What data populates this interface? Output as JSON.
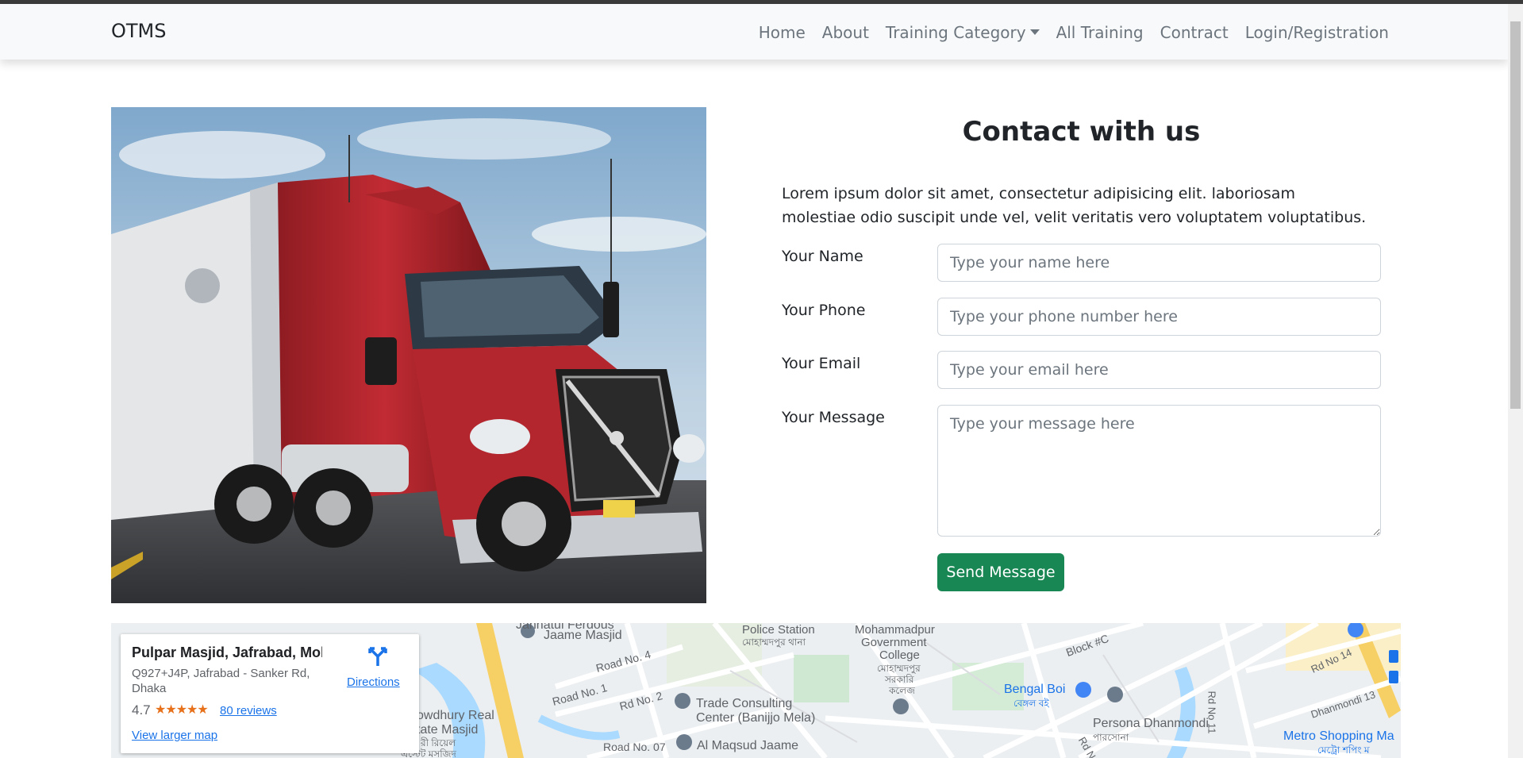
{
  "navbar": {
    "brand": "OTMS",
    "items": [
      {
        "label": "Home"
      },
      {
        "label": "About"
      },
      {
        "label": "Training Category",
        "has_dropdown": true
      },
      {
        "label": "All Training"
      },
      {
        "label": "Contract"
      },
      {
        "label": "Login/Registration"
      }
    ]
  },
  "hero_image": {
    "alt": "Red semi truck",
    "icon": "truck-photo"
  },
  "contact": {
    "title": "Contact with us",
    "intro": "Lorem ipsum dolor sit amet, consectetur adipisicing elit. laboriosam molestiae odio suscipit unde vel, velit veritatis vero voluptatem voluptatibus.",
    "fields": {
      "name": {
        "label": "Your Name",
        "placeholder": "Type your name here",
        "value": ""
      },
      "phone": {
        "label": "Your Phone",
        "placeholder": "Type your phone number here",
        "value": ""
      },
      "email": {
        "label": "Your Email",
        "placeholder": "Type your email here",
        "value": ""
      },
      "message": {
        "label": "Your Message",
        "placeholder": "Type your message here",
        "value": ""
      }
    },
    "submit_label": "Send Message",
    "submit_color": "#198754"
  },
  "map": {
    "card": {
      "place_name": "Pulpar Masjid, Jafrabad, Moh...",
      "address": "Q927+J4P, Jafrabad - Sanker Rd, Dhaka",
      "rating": "4.7",
      "stars": "★★★★★",
      "reviews": "80 reviews",
      "larger_map": "View larger map",
      "directions": "Directions"
    },
    "labels": {
      "jannatul": "Jannatul Ferdous",
      "jaame": "Jaame Masjid",
      "police1": "Police Station",
      "police2": "মোহাম্মদপুর থানা",
      "gov1": "Mohammadpur",
      "gov2": "Government",
      "gov3": "College",
      "gov4": "মোহাম্মদপুর",
      "gov5": "সরকারি",
      "gov6": "কলেজ",
      "blockc": "Block #C",
      "road4": "Road No. 4",
      "road1": "Road No. 1",
      "rd2": "Rd No. 2",
      "road07": "Road No. 07",
      "trade1": "Trade Consulting",
      "trade2": "Center (Banijjo Mela)",
      "maqsud": "Al Maqsud Jaame",
      "bengalboi": "Bengal Boi",
      "bengalboi_bn": "বেঙ্গল বই",
      "persona": "Persona Dhanmondi",
      "persona_bn": "পারসোনা",
      "rd14": "Rd No 14",
      "rd11": "Rd No 11",
      "dhan13": "Dhanmondi 13",
      "metro": "Metro Shopping Ma",
      "metro_bn": "মেট্রো শপিং ম",
      "chowdhury1": "owdhury Real",
      "chowdhury2": "tate Masjid",
      "chowdhury3": "রী রিয়েল",
      "chowdhury4": "এস্টেট মসজিদ",
      "rdn": "Rd N"
    }
  }
}
